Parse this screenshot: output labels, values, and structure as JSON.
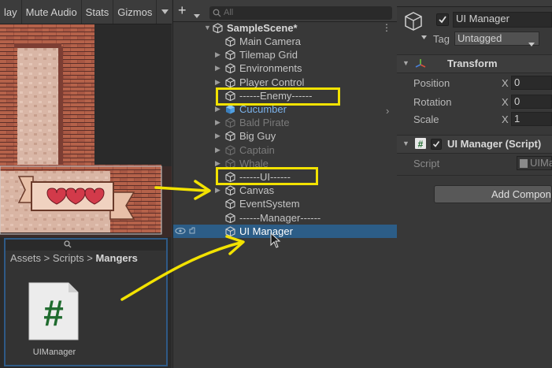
{
  "game_toolbar": {
    "play_label": "lay",
    "mute_label": "Mute Audio",
    "stats_label": "Stats",
    "gizmos_label": "Gizmos"
  },
  "project": {
    "breadcrumb": [
      "Assets",
      "Scripts",
      "Mangers"
    ],
    "asset_name": "UIManager"
  },
  "hierarchy": {
    "search_placeholder": "All",
    "scene_name": "SampleScene*",
    "items": [
      {
        "label": "Main Camera",
        "state": "normal"
      },
      {
        "label": "Tilemap Grid",
        "state": "normal"
      },
      {
        "label": "Environments",
        "state": "normal"
      },
      {
        "label": "Player Control",
        "state": "normal"
      },
      {
        "label": "------Enemy------",
        "state": "normal"
      },
      {
        "label": "Cucumber",
        "state": "prefab"
      },
      {
        "label": "Bald Pirate",
        "state": "disabled"
      },
      {
        "label": "Big Guy",
        "state": "normal"
      },
      {
        "label": "Captain",
        "state": "disabled"
      },
      {
        "label": "Whale",
        "state": "disabled"
      },
      {
        "label": "------UI------",
        "state": "normal"
      },
      {
        "label": "Canvas",
        "state": "normal"
      },
      {
        "label": "EventSystem",
        "state": "normal"
      },
      {
        "label": "------Manager------",
        "state": "normal"
      },
      {
        "label": "UI Manager",
        "state": "selected"
      }
    ]
  },
  "inspector": {
    "object_name": "UI Manager",
    "tag_label": "Tag",
    "tag_value": "Untagged",
    "transform_title": "Transform",
    "position_label": "Position",
    "rotation_label": "Rotation",
    "scale_label": "Scale",
    "axis_x": "X",
    "position_x": "0",
    "rotation_x": "0",
    "scale_x": "1",
    "script_component_title": "UI Manager (Script)",
    "script_label": "Script",
    "script_value": "UIMa",
    "add_component_label": "Add Compon"
  },
  "colors": {
    "selection": "#2c5d87",
    "highlight_box": "#f2e200",
    "prefab_text": "#7cb2ea"
  }
}
